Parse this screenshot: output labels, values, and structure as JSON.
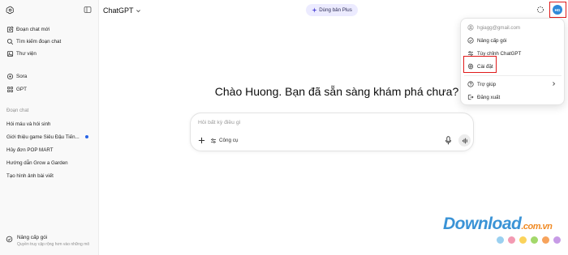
{
  "sidebar": {
    "nav": [
      {
        "label": "Đoạn chat mới",
        "icon": "new-chat-icon"
      },
      {
        "label": "Tìm kiếm đoạn chat",
        "icon": "search-icon"
      },
      {
        "label": "Thư viện",
        "icon": "library-icon"
      }
    ],
    "apps": [
      {
        "label": "Sora",
        "icon": "sora-icon"
      },
      {
        "label": "GPT",
        "icon": "gpt-icon"
      }
    ],
    "section_label": "Đoạn chat",
    "chats": [
      {
        "label": "Hói máu và hói sinh",
        "unread": false
      },
      {
        "label": "Giới thiệu game Siêu Đậu Tiến...",
        "unread": true
      },
      {
        "label": "Hủy đơn POP MART",
        "unread": false
      },
      {
        "label": "Hướng dẫn Grow a Garden",
        "unread": false
      },
      {
        "label": "Tạo hình ảnh bài viết",
        "unread": false
      }
    ],
    "upgrade": {
      "title": "Nâng cấp gói",
      "subtitle": "Quyền truy cập rộng hơn vào những mô"
    }
  },
  "header": {
    "model": "ChatGPT",
    "plus_button": "Dùng bản Plus",
    "avatar_initials": "HG"
  },
  "main": {
    "greeting": "Chào Huong. Bạn đã sẵn sàng khám phá chưa?",
    "composer": {
      "placeholder": "Hỏi bất kỳ điều gì",
      "tools_label": "Công cụ"
    }
  },
  "menu": {
    "email": "hgiagg@gmail.com",
    "items": [
      {
        "label": "Nâng cấp gói",
        "icon": "upgrade-icon"
      },
      {
        "label": "Tùy chỉnh ChatGPT",
        "icon": "sliders-icon"
      },
      {
        "label": "Cài đặt",
        "icon": "gear-icon"
      }
    ],
    "help": "Trợ giúp",
    "logout": "Đăng xuất"
  },
  "watermark": {
    "text": "Download.com.vn",
    "dot_colors": [
      "#9ad0f0",
      "#f39ab2",
      "#fbd35b",
      "#a3d86b",
      "#f7a35c",
      "#c79be6"
    ]
  },
  "colors": {
    "accent": "#2864e6",
    "highlight": "#e01a1a",
    "plus_bg": "#ecebff",
    "avatar_bg": "#2f8ad9"
  }
}
